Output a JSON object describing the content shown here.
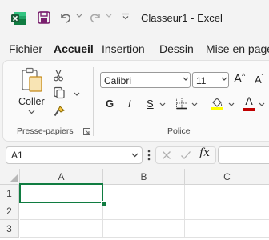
{
  "titlebar": {
    "title": "Classeur1 - Excel"
  },
  "tabs": [
    {
      "label": "Fichier"
    },
    {
      "label": "Accueil"
    },
    {
      "label": "Insertion"
    },
    {
      "label": "Dessin"
    },
    {
      "label": "Mise en page"
    }
  ],
  "ribbon": {
    "clipboard": {
      "paste_label": "Coller",
      "group_label": "Presse-papiers"
    },
    "font": {
      "font_name": "Calibri",
      "font_size": "11",
      "bold": "G",
      "italic": "I",
      "underline": "S",
      "grow": "A",
      "shrink": "A",
      "font_color_letter": "A",
      "group_label": "Police"
    }
  },
  "formula": {
    "cell_ref": "A1",
    "fx": "fx"
  },
  "sheet": {
    "columns": [
      "A",
      "B",
      "C"
    ],
    "rows": [
      "1",
      "2",
      "3"
    ]
  },
  "colors": {
    "accent": "#107c41",
    "highlight": "#ffff00",
    "font_red": "#c00000"
  }
}
